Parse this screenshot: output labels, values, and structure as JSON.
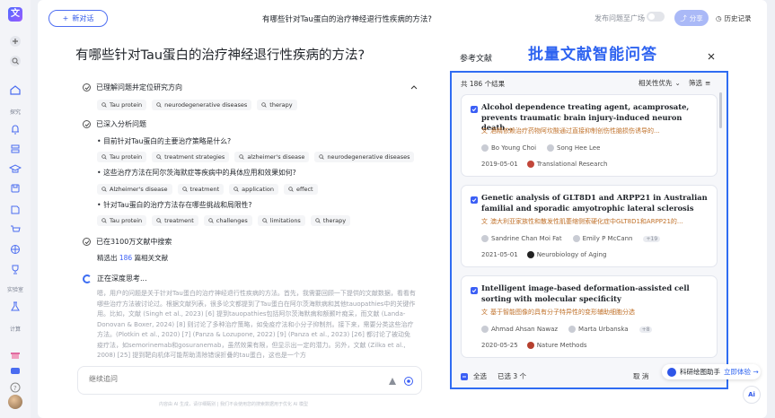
{
  "rail": {
    "logo": "文",
    "labels": {
      "explore": "探究",
      "lab": "实验室",
      "compute": "计算"
    }
  },
  "topbar": {
    "new_chat": "新对话",
    "title": "有哪些针对Tau蛋白的治疗神经退行性疾病的方法?",
    "publish": "发布问题至广场",
    "share": "分享",
    "history": "历史记录"
  },
  "question": "有哪些针对Tau蛋白的治疗神经退行性疾病的方法?",
  "steps": {
    "s1": "已理解问题并定位研究方向",
    "s1_tags": [
      "Tau protein",
      "neurodegenerative diseases",
      "therapy"
    ],
    "s2": "已深入分析问题",
    "q1": "目前针对Tau蛋白的主要治疗策略是什么?",
    "q1_tags": [
      "Tau protein",
      "treatment strategies",
      "alzheimer's disease",
      "neurodegenerative diseases"
    ],
    "q2": "这些治疗方法在阿尔茨海默症等疾病中的具体应用和效果如何?",
    "q2_tags": [
      "Alzheimer's disease",
      "treatment",
      "application",
      "effect"
    ],
    "q3": "针对Tau蛋白的治疗方法存在哪些挑战和局限性?",
    "q3_tags": [
      "Tau protein",
      "treatment",
      "challenges",
      "limitations",
      "therapy"
    ],
    "s3": "已在3100万文献中搜索",
    "s3_pre": "精选出",
    "s3_num": "186",
    "s3_post": "篇相关文献",
    "s4": "正在深度思考...",
    "para": "嗯，用户的问题是关于针对Tau蛋白的治疗神经退行性疾病的方法。首先，我需要回顾一下提供的文献数据，看看有哪些治疗方法被讨论过。根据文献列表，很多论文都提到了Tau蛋白在阿尔茨海默病和其他tauopathies中的关键作用。比如，文献 (Singh et al., 2023) [6] 提到tauopathies包括阿尔茨海默病和额颞叶痴呆，而文献 (Landa-Donovan & Boxer, 2024) [8] 则讨论了多种治疗策略，如免疫疗法和小分子抑制剂。接下来，需要分类这些治疗方法。(Plotkin et al., 2020) [7] (Panza & Lozupone, 2022) [9] (Panza et al., 2023) [26] 都讨论了被动免疫疗法，如semorinemab和gosuranemab，虽然效果有限，但显示出一定的潜力。另外，文献 (Zilka et al., 2008) [25] 提到靶向机体可能帮助清除错误折叠的tau蛋白，这也是一个方"
  },
  "input": {
    "placeholder": "继续追问",
    "disclaimer": "内容由 AI 生成，请仔细甄别 | 我们不会使用您的搜索数据用于优化 AI 模型"
  },
  "refs": {
    "title": "参考文献",
    "banner": "批量文献智能问答",
    "count": "共 186 个结果",
    "sort": "相关性优先",
    "filter": "筛选",
    "cards": [
      {
        "title": "Alcohol dependence treating agent, acamprosate, prevents traumatic brain injury-induced neuron death...",
        "translation": "酒精依赖治疗药物阿坎酸通过直接抑制创伤性脑损伤诱导的...",
        "authors": [
          "Bo Young Choi",
          "Song Hee Lee"
        ],
        "more": "",
        "date": "2019-05-01",
        "journal": "Translational Research"
      },
      {
        "title": "Genetic analysis of GLT8D1 and ARPP21 in Australian familial and sporadic amyotrophic lateral sclerosis",
        "translation": "澳大利亚家族性和散发性肌萎缩侧索硬化症中GLT8D1和ARPP21的...",
        "authors": [
          "Sandrine Chan Moi Fat",
          "Emily P McCann"
        ],
        "more": "+19",
        "date": "2021-05-01",
        "journal": "Neurobiology of Aging"
      },
      {
        "title": "Intelligent image-based deformation-assisted cell sorting with molecular specificity",
        "translation": "基于智能图像的具有分子特异性的变形辅助细胞分选",
        "authors": [
          "Ahmad Ahsan Nawaz",
          "Marta Urbanska"
        ],
        "more": "+8",
        "date": "2020-05-25",
        "journal": "Nature Methods"
      }
    ],
    "select_all": "全选",
    "selected": "已选 3 个",
    "cancel": "取 消"
  },
  "assistant": {
    "label": "科研绘图助手",
    "link": "立即体验 →"
  },
  "ai_fab": "Ai",
  "colors": {
    "accent": "#2e63f0",
    "panel_border": "#2f6cf2",
    "translation": "#c0712a"
  }
}
